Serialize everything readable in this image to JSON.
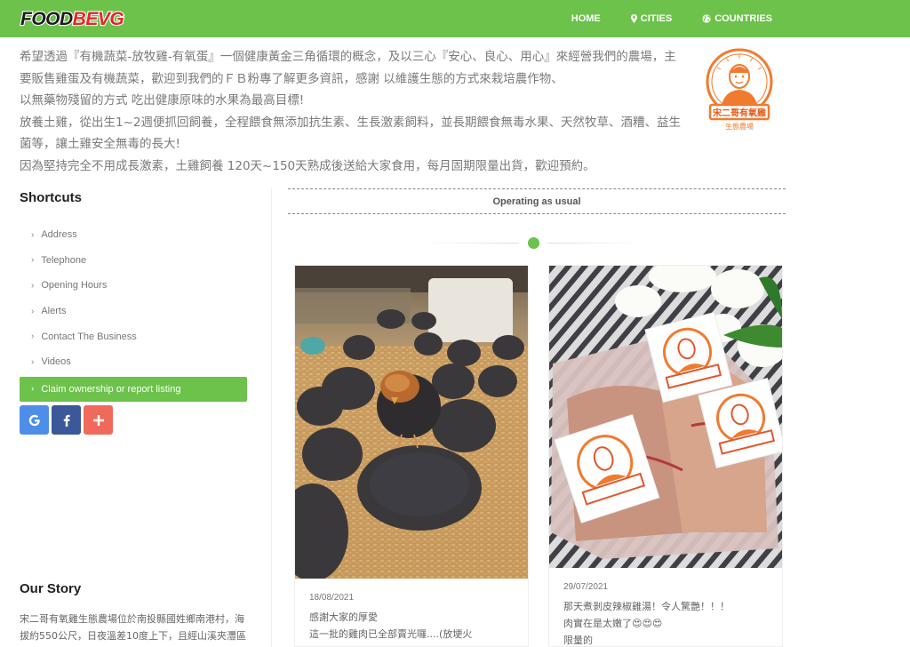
{
  "header": {
    "logo_text": "FOODBEVG",
    "nav": [
      {
        "label": "HOME",
        "icon": "none"
      },
      {
        "label": "CITIES",
        "icon": "map-marker-icon"
      },
      {
        "label": "COUNTRIES",
        "icon": "globe-icon"
      }
    ],
    "colors": {
      "bar": "#6cc24a",
      "logo_red": "#e3262a"
    }
  },
  "intro": {
    "lines": [
      "希望透過『有機蔬菜-放牧雞-有氧蛋』一個健康黃金三角循環的概念，及以三心『安心、良心、用心』來經營我們的農場，主",
      "要販售雞蛋及有機蔬菜，歡迎到我們的ＦＢ粉專了解更多資訊，感謝 以維護生態的方式來栽培農作物、",
      "以無藥物殘留的方式 吃出健康原味的水果為最高目標!",
      "放養土雞，從出生1~2週便抓回飼養，全程餵食無添加抗生素、生長激素飼料，並長期餵食無毒水果、天然牧草、酒糟、益生",
      "菌等，讓土雞安全無毒的長大!",
      "因為堅持完全不用成長激素，土雞飼養 120天~150天熟成後送給大家食用，每月固期限量出貨，歡迎預約。"
    ],
    "badge_logo_text": "宋二哥有氧雞",
    "badge_logo_subtext": "生態農場"
  },
  "sidebar": {
    "title": "Shortcuts",
    "items": [
      {
        "label": "Address"
      },
      {
        "label": "Telephone"
      },
      {
        "label": "Opening Hours"
      },
      {
        "label": "Alerts"
      },
      {
        "label": "Contact The Business"
      },
      {
        "label": "Videos"
      },
      {
        "label": "Claim ownership or report listing"
      }
    ],
    "social": [
      {
        "name": "google",
        "glyph": "G"
      },
      {
        "name": "facebook",
        "glyph": "f"
      },
      {
        "name": "more",
        "glyph": "+"
      }
    ]
  },
  "story": {
    "title": "Our Story",
    "lines": [
      "宋二哥有氧雞生態農場位於南投縣國姓鄉南港村，海",
      "拔約550公尺，日夜溫差10度上下，且經山溪夾灃區"
    ]
  },
  "main": {
    "status": "Operating as usual",
    "posts": [
      {
        "date": "18/08/2021",
        "lines": [
          "感謝大家的厚愛",
          "這一批的雞肉已全部賣光囉....(放埂火"
        ]
      },
      {
        "date": "29/07/2021",
        "lines": [
          "那天煮剝皮辣椒雞湯！令人驚艷！！！",
          "肉實在是太嫩了😍😍😍",
          "限量的"
        ]
      }
    ]
  }
}
